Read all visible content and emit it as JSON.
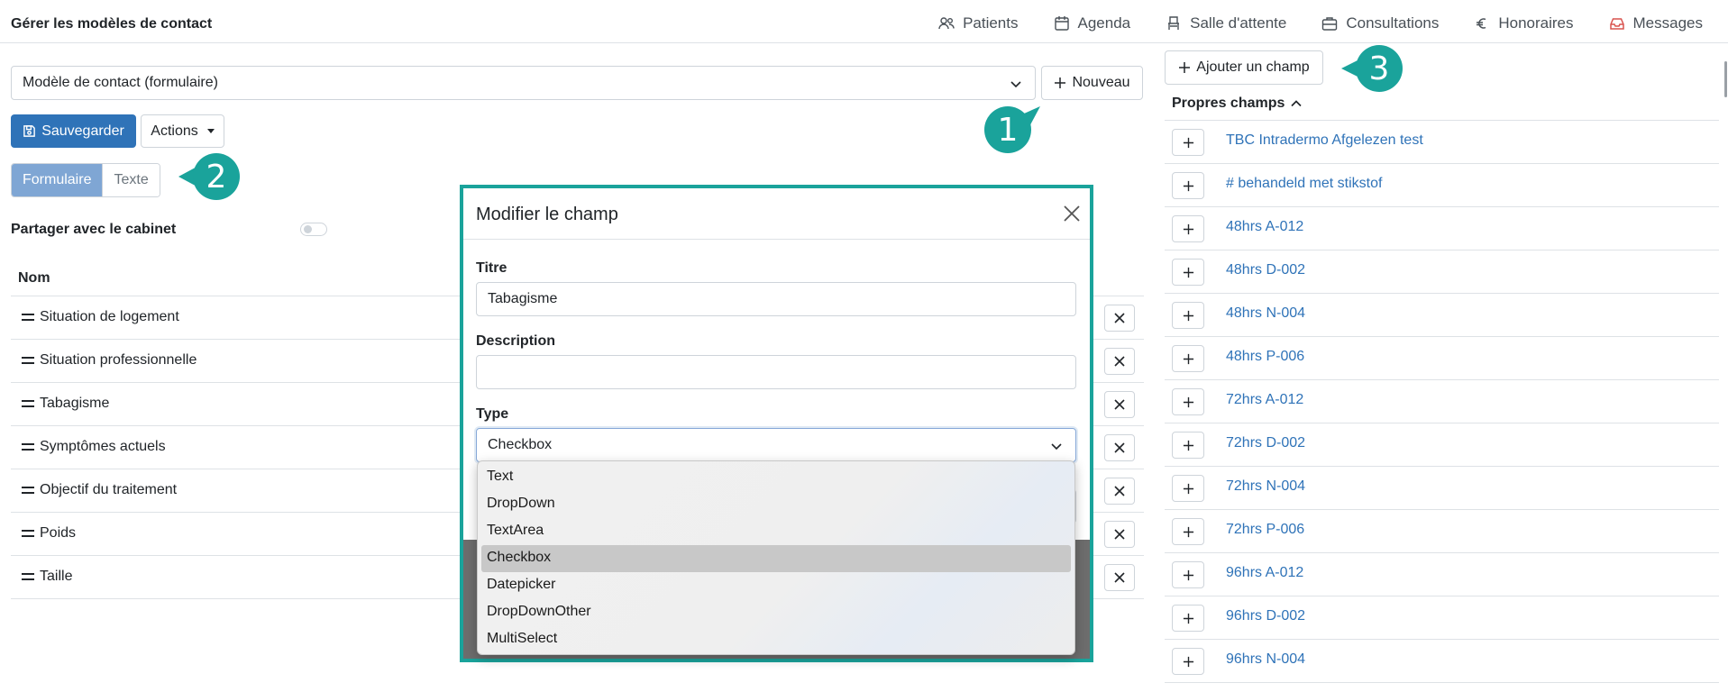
{
  "header": {
    "title": "Gérer les modèles de contact",
    "nav": [
      {
        "label": "Patients",
        "icon": "users-icon"
      },
      {
        "label": "Agenda",
        "icon": "calendar-icon"
      },
      {
        "label": "Salle d'attente",
        "icon": "chair-icon"
      },
      {
        "label": "Consultations",
        "icon": "briefcase-icon"
      },
      {
        "label": "Honoraires",
        "icon": "euro-icon"
      },
      {
        "label": "Messages",
        "icon": "inbox-icon"
      }
    ]
  },
  "left": {
    "template_select": "Modèle de contact (formulaire)",
    "new_button": "Nouveau",
    "save_button": "Sauvegarder",
    "actions_button": "Actions",
    "segments": [
      "Formulaire",
      "Texte"
    ],
    "active_segment": "Formulaire",
    "share_label": "Partager avec le cabinet",
    "share_enabled": false,
    "column_header": "Nom",
    "fields": [
      "Situation de logement",
      "Situation professionnelle",
      "Tabagisme",
      "Symptômes actuels",
      "Objectif du traitement",
      "Poids",
      "Taille"
    ]
  },
  "right": {
    "add_field_button": "Ajouter un champ",
    "own_fields_title": "Propres champs",
    "own_fields": [
      "TBC Intradermo Afgelezen test",
      "# behandeld met stikstof",
      "48hrs A-012",
      "48hrs D-002",
      "48hrs N-004",
      "48hrs P-006",
      "72hrs A-012",
      "72hrs D-002",
      "72hrs N-004",
      "72hrs P-006",
      "96hrs A-012",
      "96hrs D-002",
      "96hrs N-004"
    ]
  },
  "modal": {
    "title": "Modifier le champ",
    "title_label": "Titre",
    "title_value": "Tabagisme",
    "description_label": "Description",
    "description_value": "",
    "type_label": "Type",
    "type_value": "Checkbox",
    "type_options": [
      "Text",
      "DropDown",
      "TextArea",
      "Checkbox",
      "Datepicker",
      "DropDownOther",
      "MultiSelect"
    ],
    "selected_option": "Checkbox"
  },
  "callouts": [
    "1",
    "2",
    "3"
  ],
  "colors": {
    "primary": "#2f73b8",
    "segment_active": "#7fa6d4",
    "callout": "#1aa39b",
    "link": "#2f73b8"
  }
}
